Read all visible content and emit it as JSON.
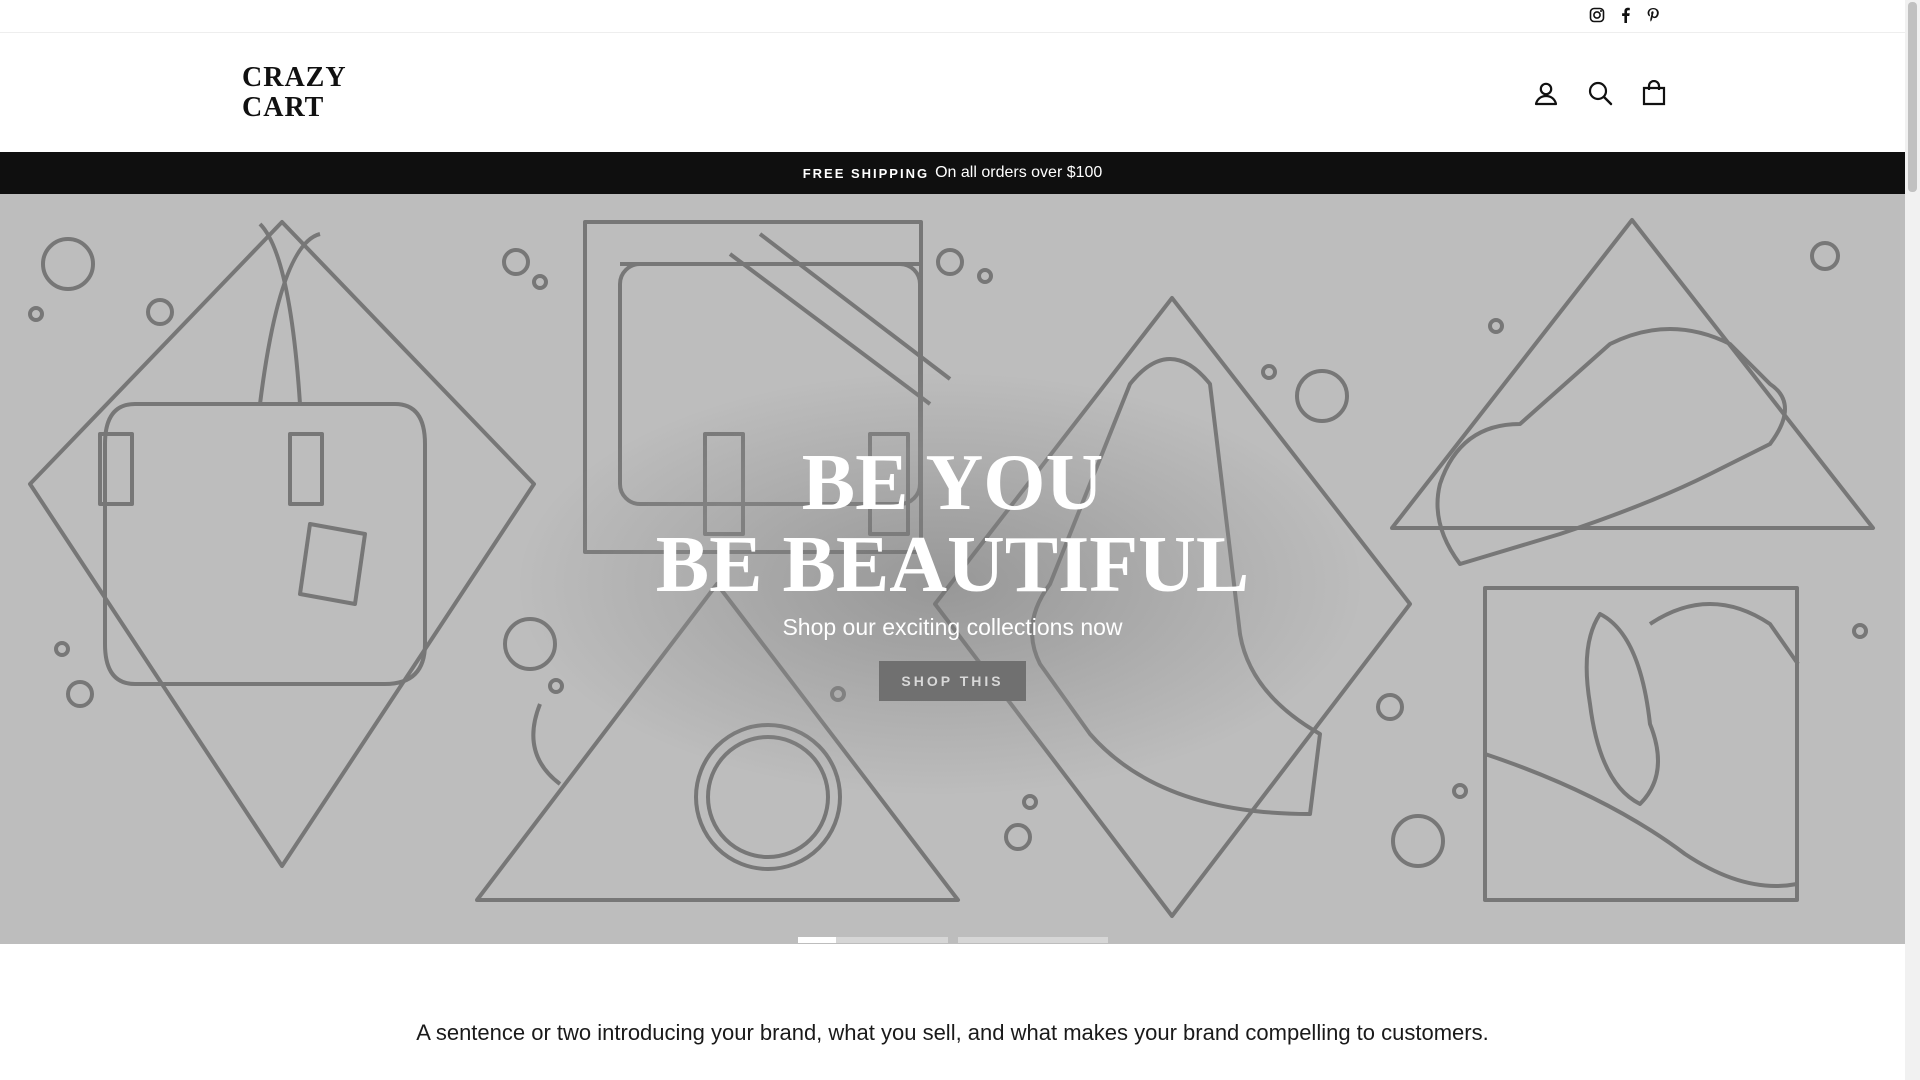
{
  "social": {
    "instagram": "instagram-icon",
    "facebook": "facebook-icon",
    "pinterest": "pinterest-icon"
  },
  "header": {
    "logo_line1": "CRAZY",
    "logo_line2": "CART"
  },
  "header_icons": [
    "user-icon",
    "search-icon",
    "cart-icon"
  ],
  "announcement": {
    "strong": "FREE SHIPPING",
    "text": "On all orders over $100"
  },
  "hero": {
    "title_line1": "BE YOU",
    "title_line2": "BE BEAUTIFUL",
    "subtitle": "Shop our exciting collections now",
    "button": "SHOP THIS",
    "slide_progress": 0.25
  },
  "intro": {
    "text": "A sentence or two introducing your brand, what you sell, and what makes your brand compelling to customers."
  },
  "colors": {
    "announcement_bg": "#0f0f0f",
    "hero_bg": "#bdbdbd",
    "line_art": "#777777",
    "button_bg": "#707070"
  }
}
